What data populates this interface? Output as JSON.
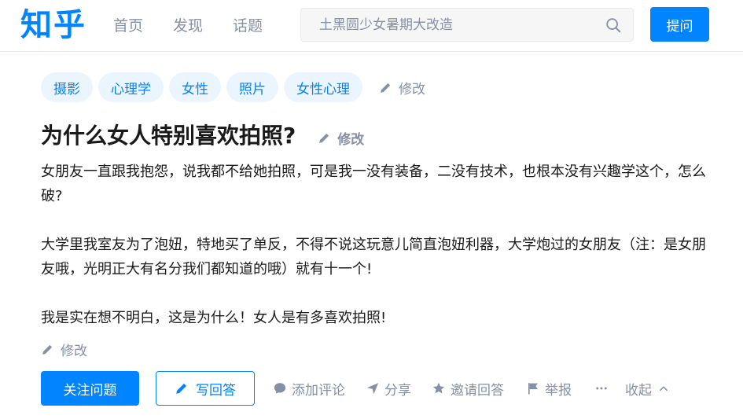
{
  "header": {
    "logo": "知乎",
    "nav": [
      "首页",
      "发现",
      "话题"
    ],
    "search_placeholder": "土黑圆少女暑期大改造",
    "ask_label": "提问"
  },
  "topics": [
    "摄影",
    "心理学",
    "女性",
    "照片",
    "女性心理"
  ],
  "edit_label": "修改",
  "question": {
    "title": "为什么女人特别喜欢拍照?",
    "paragraphs": [
      "女朋友一直跟我抱怨，说我都不给她拍照，可是我一没有装备，二没有技术，也根本没有兴趣学这个，怎么破?",
      "大学里我室友为了泡妞，特地买了单反，不得不说这玩意儿简直泡妞利器，大学炮过的女朋友（注：是女朋友哦，光明正大有名分我们都知道的哦）就有十一个!",
      "我是实在想不明白，这是为什么！女人是有多喜欢拍照!"
    ]
  },
  "actions": {
    "follow": "关注问题",
    "answer": "写回答",
    "comment": "添加评论",
    "share": "分享",
    "invite": "邀请回答",
    "report": "举报",
    "more": "···",
    "collapse": "收起"
  },
  "colors": {
    "brand": "#0084ff",
    "muted": "#8590a6",
    "topic_bg": "#ebf5ff"
  }
}
